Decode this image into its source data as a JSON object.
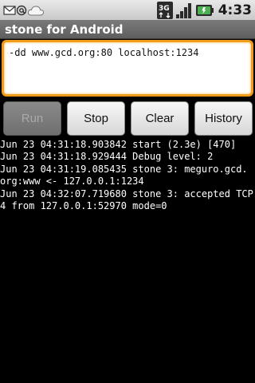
{
  "status_bar": {
    "time": "4:33",
    "network_type": "3G",
    "icons": [
      "mail-icon",
      "at-sign-icon",
      "cloud-icon",
      "3g-data-icon",
      "signal-icon",
      "battery-icon"
    ]
  },
  "app": {
    "title": "stone for Android"
  },
  "command_input": {
    "value": "-dd www.gcd.org:80 localhost:1234"
  },
  "buttons": {
    "run": "Run",
    "stop": "Stop",
    "clear": "Clear",
    "history": "History"
  },
  "log": {
    "lines": [
      "Jun 23 04:31:18.903842 start (2.3e) [470]",
      "Jun 23 04:31:18.929444 Debug level: 2",
      "Jun 23 04:31:19.085435 stone 3: meguro.gcd.",
      "org:www <- 127.0.0.1:1234",
      "Jun 23 04:32:07.719680 stone 3: accepted TCP",
      "4 from 127.0.0.1:52970 mode=0"
    ]
  },
  "colors": {
    "accent_focus": "#f39c19",
    "battery_green": "#4caf50",
    "background": "#000000"
  }
}
